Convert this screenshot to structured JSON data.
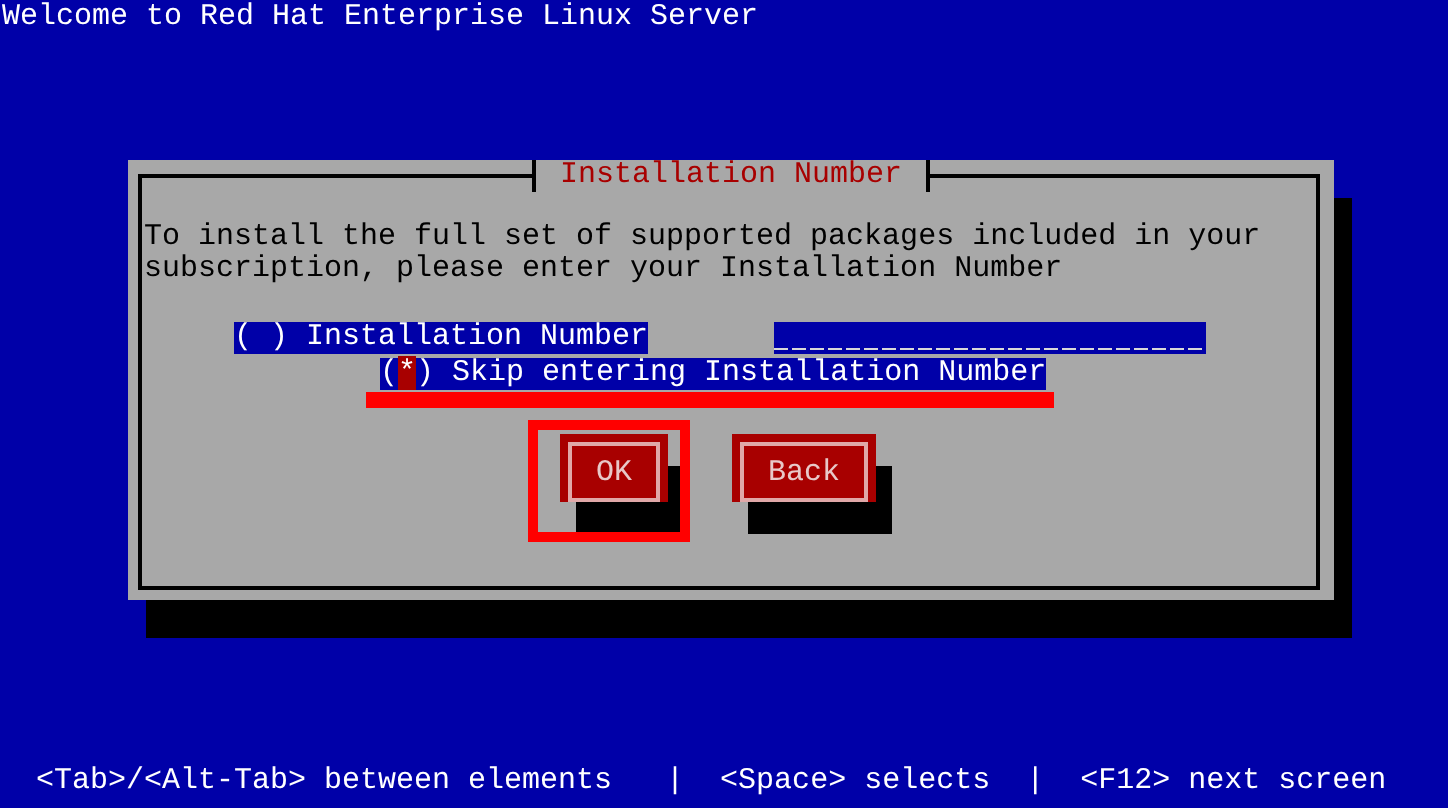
{
  "screen_title": "Welcome to Red Hat Enterprise Linux Server",
  "dialog": {
    "title": "Installation Number",
    "message": "To install the full set of supported packages included in your subscription, please enter your Installation Number",
    "options": [
      {
        "bullet": "( )",
        "label": "Installation Number",
        "selected": false,
        "underlined": false,
        "kind": "entry"
      },
      {
        "bullet": "(*)",
        "label": "Skip entering Installation Number",
        "selected": true,
        "underlined": true,
        "kind": "plain"
      }
    ],
    "buttons": [
      {
        "label": "OK",
        "highlighted": true
      },
      {
        "label": "Back",
        "highlighted": false
      }
    ]
  },
  "status_bar": "<Tab>/<Alt-Tab> between elements   |  <Space> selects  |  <F12> next screen"
}
